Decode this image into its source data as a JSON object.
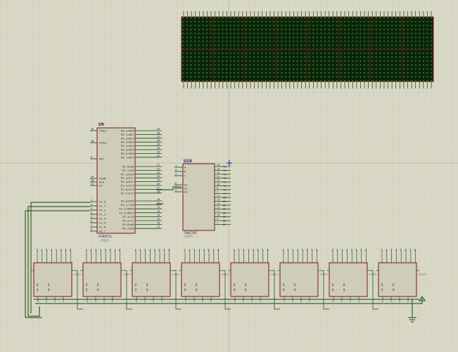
{
  "colors": {
    "background": "#d9d7c5",
    "grid": "#c6c4b0",
    "component_fill": "#cfcdb8",
    "outline": "#7a1515",
    "wire": "#0f4a0f",
    "matrix_bg": "#0b2309",
    "matrix_dot": "#2d6b22",
    "label": "#1b1b6a",
    "power": "#005a00"
  },
  "u9": {
    "ref": "U9",
    "part": "AT89C51",
    "text_tag": "<TEXT>",
    "left_pins": [
      {
        "num": "19",
        "name": "XTAL1"
      },
      {
        "num": "18",
        "name": "XTAL2"
      },
      {
        "num": "9",
        "name": "RST"
      },
      {
        "num": "29",
        "name": "PSEN"
      },
      {
        "num": "30",
        "name": "ALE"
      },
      {
        "num": "31",
        "name": "EA"
      },
      {
        "num": "1",
        "name": "P1.0"
      },
      {
        "num": "2",
        "name": "P1.1"
      },
      {
        "num": "3",
        "name": "P1.2"
      },
      {
        "num": "4",
        "name": "P1.3"
      },
      {
        "num": "5",
        "name": "P1.4"
      },
      {
        "num": "6",
        "name": "P1.5"
      },
      {
        "num": "7",
        "name": "P1.6"
      },
      {
        "num": "8",
        "name": "P1.7"
      }
    ],
    "right_pins": [
      {
        "num": "39",
        "name": "P0.0/AD0"
      },
      {
        "num": "38",
        "name": "P0.1/AD1"
      },
      {
        "num": "37",
        "name": "P0.2/AD2"
      },
      {
        "num": "36",
        "name": "P0.3/AD3"
      },
      {
        "num": "35",
        "name": "P0.4/AD4"
      },
      {
        "num": "34",
        "name": "P0.5/AD5"
      },
      {
        "num": "33",
        "name": "P0.6/AD6"
      },
      {
        "num": "32",
        "name": "P0.7/AD7"
      },
      {
        "num": "21",
        "name": "P2.0/A8"
      },
      {
        "num": "22",
        "name": "P2.1/A9"
      },
      {
        "num": "23",
        "name": "P2.2/A10"
      },
      {
        "num": "24",
        "name": "P2.3/A11"
      },
      {
        "num": "25",
        "name": "P2.4/A12"
      },
      {
        "num": "26",
        "name": "P2.5/A13"
      },
      {
        "num": "27",
        "name": "P2.6/A14"
      },
      {
        "num": "28",
        "name": "P2.7/A15"
      },
      {
        "num": "10",
        "name": "P3.0/RXD"
      },
      {
        "num": "11",
        "name": "P3.1/TXD"
      },
      {
        "num": "12",
        "name": "P3.2/INT0"
      },
      {
        "num": "13",
        "name": "P3.3/INT1"
      },
      {
        "num": "14",
        "name": "P3.4/T0"
      },
      {
        "num": "15",
        "name": "P3.5/T1"
      },
      {
        "num": "16",
        "name": "P3.6/WR"
      },
      {
        "num": "17",
        "name": "P3.7/RD"
      }
    ]
  },
  "u10": {
    "ref": "U10",
    "part": "74HC595",
    "text_tag": "<TEXT>",
    "left_pins": [
      {
        "num": "1",
        "name": "A"
      },
      {
        "num": "2",
        "name": "B"
      },
      {
        "num": "3",
        "name": "C"
      },
      {
        "num": "6",
        "name": "E1"
      },
      {
        "num": "4",
        "name": "E2"
      },
      {
        "num": "5",
        "name": "E3"
      }
    ],
    "right_pins": [
      {
        "num": "15",
        "name": "Y0"
      },
      {
        "num": "14",
        "name": "Y1"
      },
      {
        "num": "13",
        "name": "Y2"
      },
      {
        "num": "12",
        "name": "Y3"
      },
      {
        "num": "11",
        "name": "Y4"
      },
      {
        "num": "10",
        "name": "Y5"
      },
      {
        "num": "9",
        "name": "Y6"
      },
      {
        "num": "7",
        "name": "Y7"
      },
      {
        "num": "15",
        "name": "Q0"
      },
      {
        "num": "14",
        "name": "Q1"
      },
      {
        "num": "13",
        "name": "Q2"
      },
      {
        "num": "12",
        "name": "Q3"
      },
      {
        "num": "11",
        "name": "Q4"
      },
      {
        "num": "10",
        "name": "Q5"
      },
      {
        "num": "9",
        "name": "Q6"
      },
      {
        "num": "7",
        "name": "Q7"
      }
    ]
  },
  "led_matrix": {
    "columns": 64,
    "rows": 16
  },
  "shift_register_modules": {
    "count": 8,
    "text_tag": "<TEXT>",
    "pin_labels": [
      "D0",
      "D1",
      "D2",
      "D3",
      "D4",
      "D5",
      "D6",
      "D7"
    ],
    "io_labels": [
      "SH",
      "ST",
      "DS",
      "MR",
      "Q7"
    ]
  }
}
